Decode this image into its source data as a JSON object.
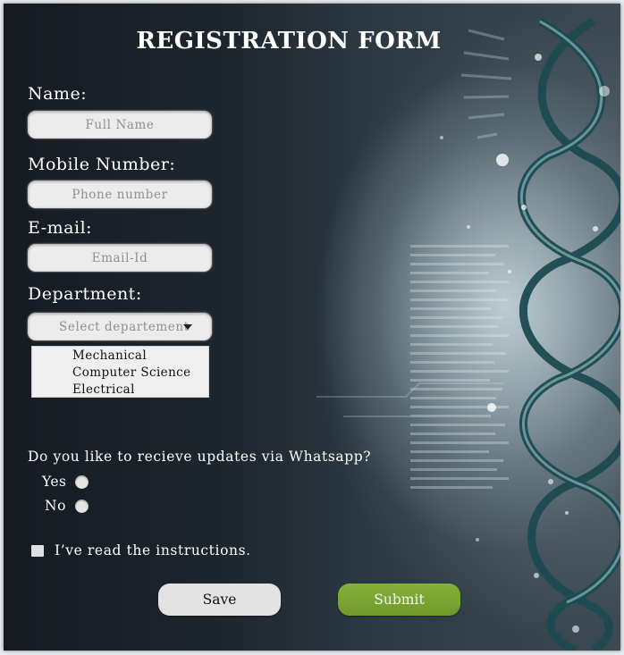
{
  "form": {
    "title": "REGISTRATION FORM",
    "name_label": "Name:",
    "name_placeholder": "Full Name",
    "mobile_label": "Mobile Number:",
    "mobile_placeholder": "Phone number",
    "email_label": "E-mail:",
    "email_placeholder": "Email-Id",
    "department_label": "Department:",
    "department_select": "Select departement",
    "department_options": [
      "Mechanical",
      "Computer Science",
      "Electrical"
    ],
    "question": "Do you like to recieve updates via Whatsapp?",
    "radio_yes": "Yes",
    "radio_no": "No",
    "checkbox_label": "I’ve read the instructions.",
    "save_label": "Save",
    "submit_label": "Submit"
  },
  "icons": {
    "dropdown": "caret-down-icon",
    "background": "dna-helix-background"
  },
  "colors": {
    "submit": "#7aa633",
    "save": "#e3e3e3",
    "field": "#ececec",
    "text": "#ffffff"
  }
}
